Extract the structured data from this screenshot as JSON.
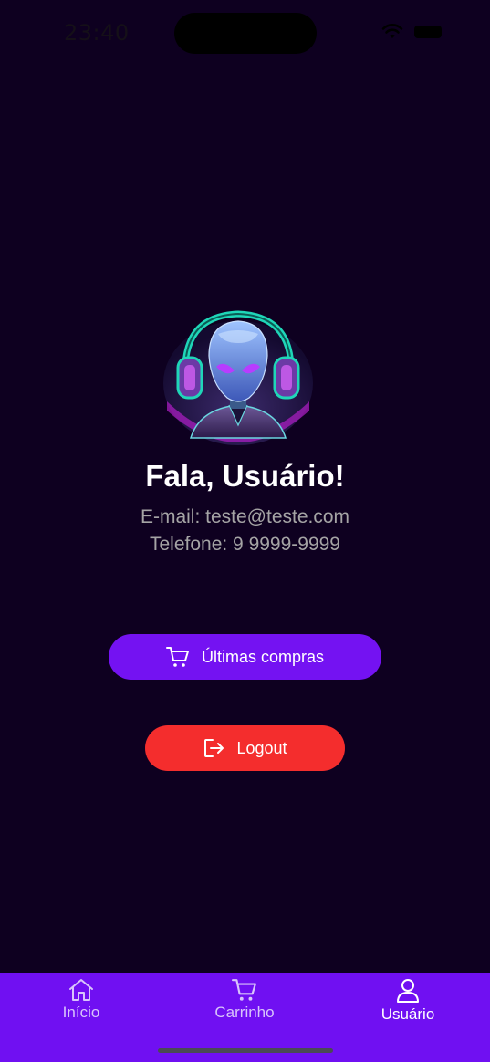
{
  "status_bar": {
    "time": "23:40"
  },
  "profile": {
    "greeting": "Fala, Usuário!",
    "email_line": "E-mail: teste@teste.com",
    "phone_line": "Telefone: 9 9999-9999"
  },
  "actions": {
    "purchases_label": "Últimas compras",
    "logout_label": "Logout"
  },
  "tab_bar": {
    "tabs": [
      {
        "label": "Início",
        "icon": "home-icon"
      },
      {
        "label": "Carrinho",
        "icon": "cart-icon"
      },
      {
        "label": "Usuário",
        "icon": "user-icon"
      }
    ],
    "active": "Usuário"
  },
  "colors": {
    "background": "#0e0020",
    "accent": "#7412f2",
    "danger": "#f42d2d",
    "tab_bar": "#7010f2"
  }
}
